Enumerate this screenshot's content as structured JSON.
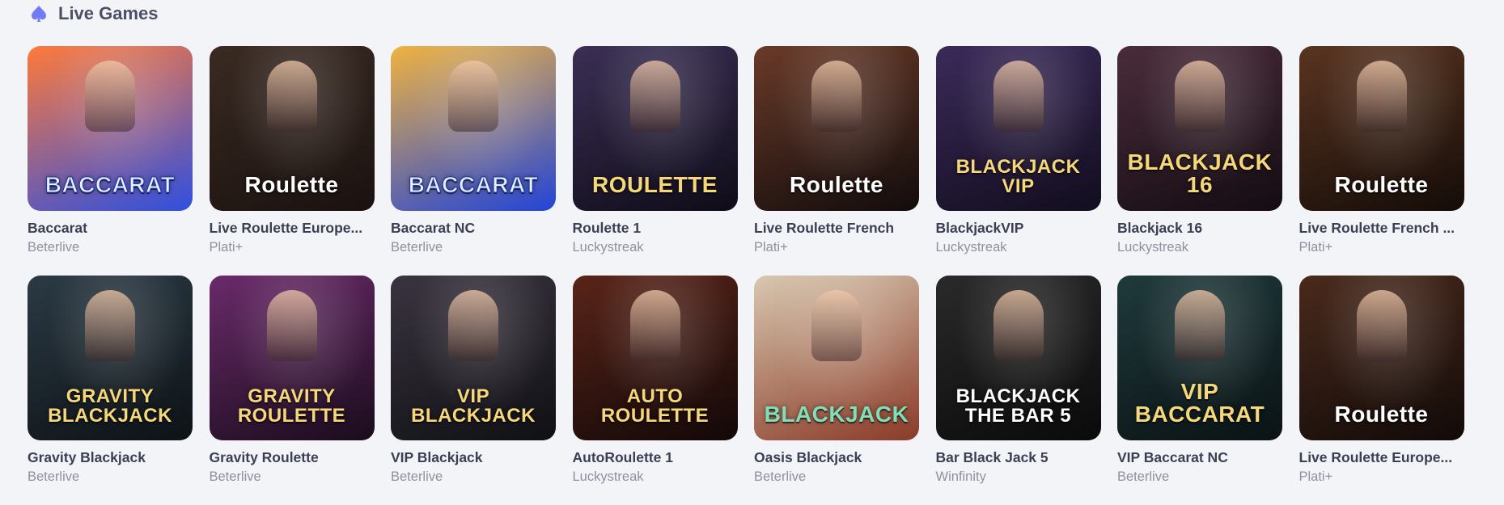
{
  "section": {
    "title": "Live Games",
    "icon": "spade-icon"
  },
  "games": [
    {
      "name": "Baccarat",
      "provider": "Beterlive",
      "art": "BACCARAT",
      "bg": [
        "#ff7a3a",
        "#2f4fe0"
      ],
      "style": "blue"
    },
    {
      "name": "Live Roulette Europe...",
      "provider": "Plati+",
      "art": "Roulette",
      "bg": [
        "#3a2a22",
        "#1a1210"
      ],
      "style": ""
    },
    {
      "name": "Baccarat NC",
      "provider": "Beterlive",
      "art": "BACCARAT",
      "bg": [
        "#f0b340",
        "#2244d8"
      ],
      "style": "blue"
    },
    {
      "name": "Roulette 1",
      "provider": "Luckystreak",
      "art": "ROULETTE",
      "bg": [
        "#3b2f55",
        "#0f0c18"
      ],
      "style": "gold"
    },
    {
      "name": "Live Roulette French",
      "provider": "Plati+",
      "art": "Roulette",
      "bg": [
        "#6a3a28",
        "#120c0c"
      ],
      "style": ""
    },
    {
      "name": "BlackjackVIP",
      "provider": "Luckystreak",
      "art": "BLACKJACK VIP",
      "bg": [
        "#3b2a5a",
        "#120d1e"
      ],
      "style": "gold"
    },
    {
      "name": "Blackjack 16",
      "provider": "Luckystreak",
      "art": "BLACKJACK 16",
      "bg": [
        "#4a2c3a",
        "#140c12"
      ],
      "style": "gold"
    },
    {
      "name": "Live Roulette French ...",
      "provider": "Plati+",
      "art": "Roulette",
      "bg": [
        "#5a3420",
        "#140c08"
      ],
      "style": ""
    },
    {
      "name": "Gravity Blackjack",
      "provider": "Beterlive",
      "art": "GRAVITY BLACKJACK",
      "bg": [
        "#2b3a44",
        "#0d1216"
      ],
      "style": "gold"
    },
    {
      "name": "Gravity Roulette",
      "provider": "Beterlive",
      "art": "GRAVITY ROULETTE",
      "bg": [
        "#6a2a6a",
        "#1a0c1c"
      ],
      "style": "gold"
    },
    {
      "name": "VIP Blackjack",
      "provider": "Beterlive",
      "art": "VIP BLACKJACK",
      "bg": [
        "#3a3440",
        "#101014"
      ],
      "style": "gold"
    },
    {
      "name": "AutoRoulette 1",
      "provider": "Luckystreak",
      "art": "AUTO ROULETTE",
      "bg": [
        "#5a2418",
        "#120808"
      ],
      "style": "gold"
    },
    {
      "name": "Oasis Blackjack",
      "provider": "Beterlive",
      "art": "BLACKJACK",
      "bg": [
        "#d8c8b0",
        "#8a3a28"
      ],
      "style": "green"
    },
    {
      "name": "Bar Black Jack 5",
      "provider": "Winfinity",
      "art": "BLACKJACK THE BAR 5",
      "bg": [
        "#2a2a2a",
        "#0a0a0a"
      ],
      "style": ""
    },
    {
      "name": "VIP Baccarat NC",
      "provider": "Beterlive",
      "art": "VIP BACCARAT",
      "bg": [
        "#1f3a3c",
        "#0a1214"
      ],
      "style": "gold"
    },
    {
      "name": "Live Roulette Europe...",
      "provider": "Plati+",
      "art": "Roulette",
      "bg": [
        "#4a2a1c",
        "#120a08"
      ],
      "style": ""
    }
  ]
}
